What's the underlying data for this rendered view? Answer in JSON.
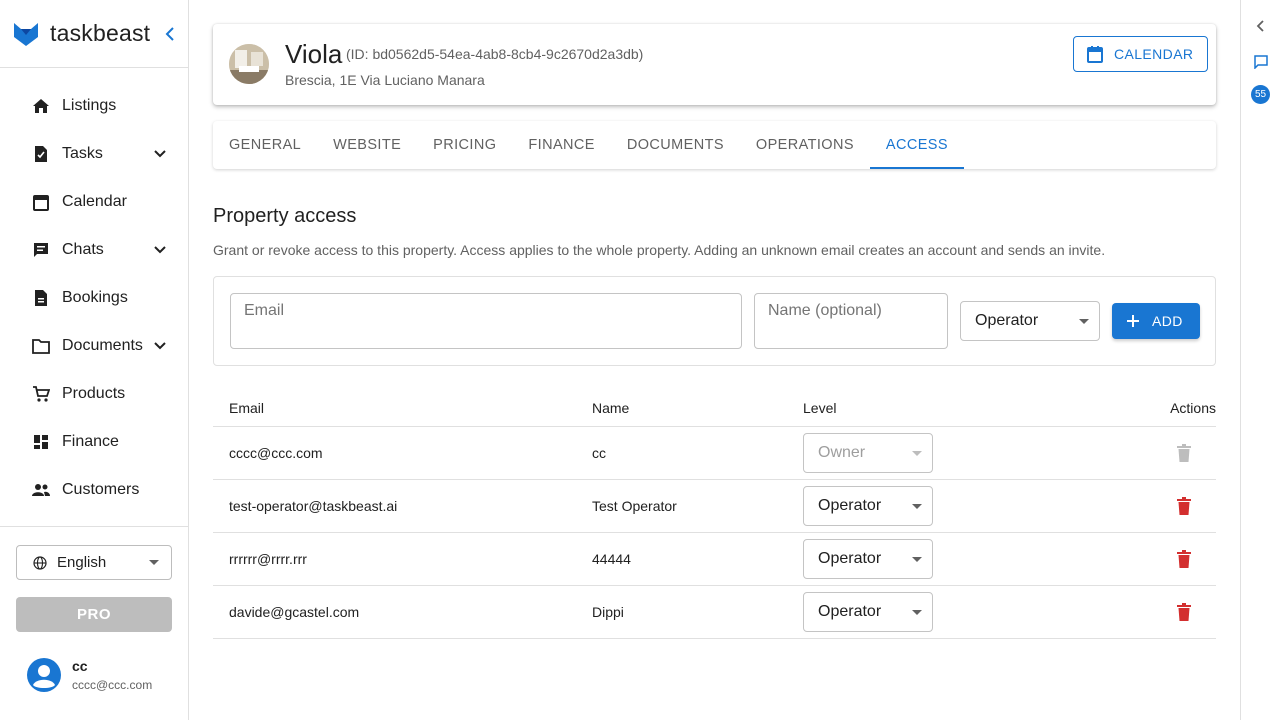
{
  "brand": {
    "name": "taskbeast",
    "accent": "#1976d2"
  },
  "sidebar": {
    "items": [
      {
        "label": "Listings",
        "icon": "home-icon",
        "expandable": false
      },
      {
        "label": "Tasks",
        "icon": "task-icon",
        "expandable": true
      },
      {
        "label": "Calendar",
        "icon": "calendar-icon",
        "expandable": false
      },
      {
        "label": "Chats",
        "icon": "chat-icon",
        "expandable": true
      },
      {
        "label": "Bookings",
        "icon": "booking-icon",
        "expandable": false
      },
      {
        "label": "Documents",
        "icon": "folder-icon",
        "expandable": true
      },
      {
        "label": "Products",
        "icon": "cart-icon",
        "expandable": false
      },
      {
        "label": "Finance",
        "icon": "dashboard-icon",
        "expandable": false
      },
      {
        "label": "Customers",
        "icon": "people-icon",
        "expandable": false
      }
    ],
    "language": "English",
    "pro_label": "PRO",
    "user": {
      "name": "cc",
      "email": "cccc@ccc.com"
    }
  },
  "rail": {
    "badge": "55"
  },
  "property": {
    "name": "Viola",
    "id_text": "(ID: bd0562d5-54ea-4ab8-8cb4-9c2670d2a3db)",
    "address": "Brescia, 1E Via Luciano Manara",
    "calendar_label": "CALENDAR"
  },
  "tabs": [
    "GENERAL",
    "WEBSITE",
    "PRICING",
    "FINANCE",
    "DOCUMENTS",
    "OPERATIONS",
    "ACCESS"
  ],
  "active_tab": "ACCESS",
  "access": {
    "title": "Property access",
    "description": "Grant or revoke access to this property. Access applies to the whole property. Adding an unknown email creates an account and sends an invite.",
    "email_placeholder": "Email",
    "name_placeholder": "Name (optional)",
    "level_value": "Operator",
    "add_label": "ADD"
  },
  "table": {
    "headers": {
      "email": "Email",
      "name": "Name",
      "level": "Level",
      "actions": "Actions"
    },
    "rows": [
      {
        "email": "cccc@ccc.com",
        "name": "cc",
        "level": "Owner",
        "disabled": true
      },
      {
        "email": "test-operator@taskbeast.ai",
        "name": "Test Operator",
        "level": "Operator",
        "disabled": false
      },
      {
        "email": "rrrrrr@rrrr.rrr",
        "name": "44444",
        "level": "Operator",
        "disabled": false
      },
      {
        "email": "davide@gcastel.com",
        "name": "Dippi",
        "level": "Operator",
        "disabled": false
      }
    ]
  }
}
